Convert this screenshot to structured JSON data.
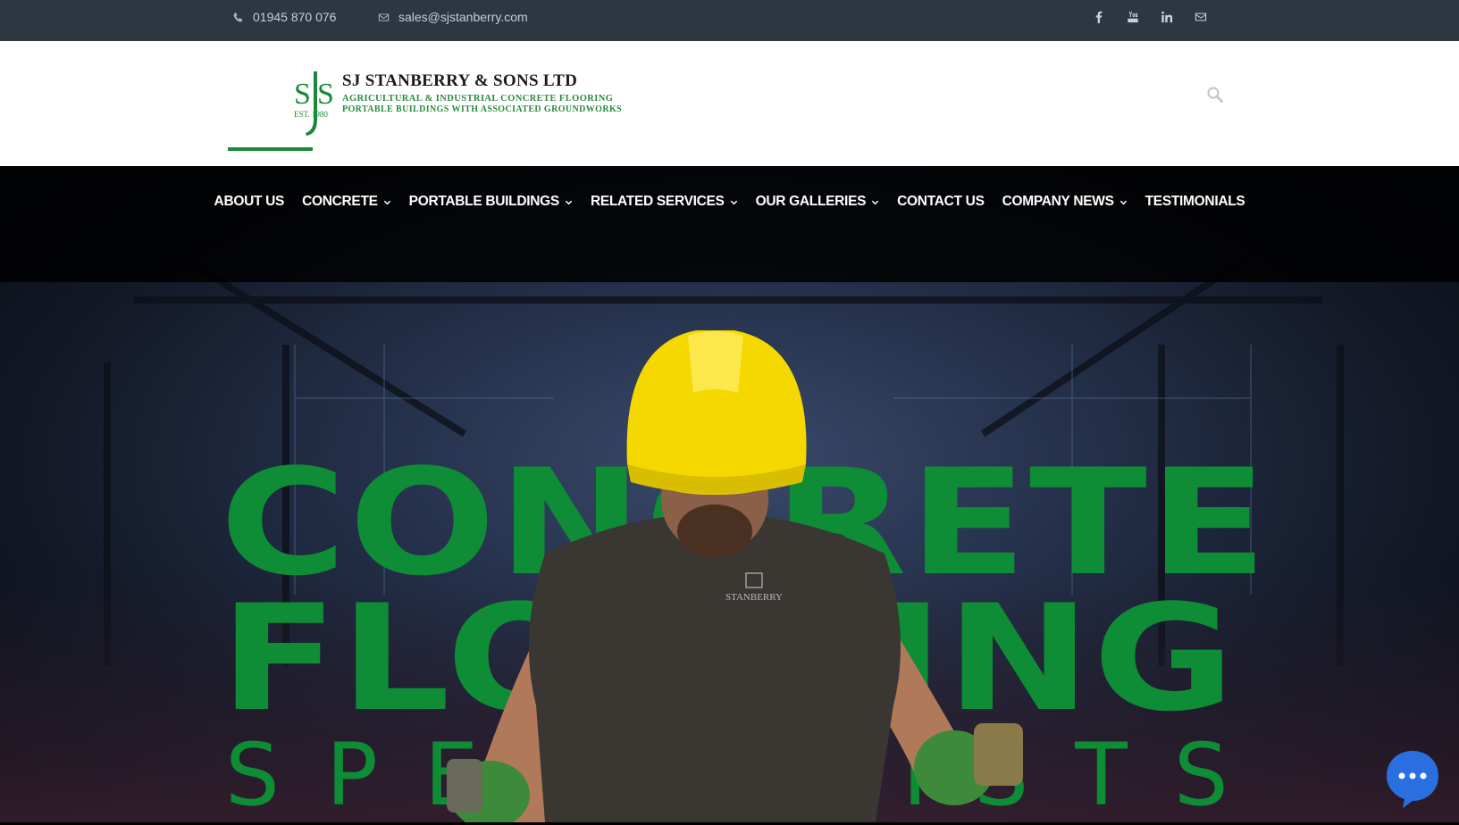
{
  "topbar": {
    "phone": "01945 870 076",
    "email": "sales@sjstanberry.com",
    "social": [
      "facebook-icon",
      "youtube-icon",
      "linkedin-icon",
      "mail-icon"
    ]
  },
  "logo": {
    "monogram": "SJS",
    "est": "EST. 1980",
    "company": "SJ STANBERRY & SONS LTD",
    "line1": "AGRICULTURAL & INDUSTRIAL CONCRETE FLOORING",
    "line2": "PORTABLE BUILDINGS WITH ASSOCIATED GROUNDWORKS"
  },
  "nav": {
    "items": [
      {
        "label": "ABOUT US",
        "dropdown": false
      },
      {
        "label": "CONCRETE",
        "dropdown": true
      },
      {
        "label": "PORTABLE BUILDINGS",
        "dropdown": true
      },
      {
        "label": "RELATED SERVICES",
        "dropdown": true
      },
      {
        "label": "OUR GALLERIES",
        "dropdown": true
      },
      {
        "label": "CONTACT US",
        "dropdown": false
      },
      {
        "label": "COMPANY NEWS",
        "dropdown": true
      },
      {
        "label": "TESTIMONIALS",
        "dropdown": false
      }
    ]
  },
  "hero": {
    "line1": "CONCRETE",
    "line2": "FLOORING",
    "line3": "SPECIALISTS",
    "shirt_logo": "STANBERRY"
  },
  "colors": {
    "topbar": "#2c3742",
    "brand_green": "#0e8c36",
    "helmet": "#f4d800",
    "chat": "#2a6fe0"
  }
}
